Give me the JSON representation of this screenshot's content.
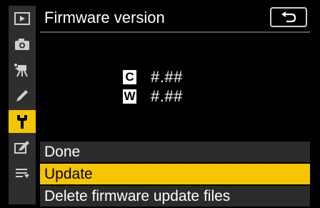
{
  "header": {
    "title": "Firmware version"
  },
  "versions": [
    {
      "badge": "C",
      "value": "#.##"
    },
    {
      "badge": "W",
      "value": "#.##"
    }
  ],
  "menu": {
    "items": [
      {
        "label": "Done",
        "selected": false
      },
      {
        "label": "Update",
        "selected": true
      },
      {
        "label": "Delete firmware update files",
        "selected": false
      }
    ]
  },
  "sidebar": {
    "items": [
      {
        "icon": "playback-icon",
        "active": false
      },
      {
        "icon": "camera-icon",
        "active": false
      },
      {
        "icon": "movie-camera-icon",
        "active": false
      },
      {
        "icon": "pencil-icon",
        "active": false
      },
      {
        "icon": "wrench-icon",
        "active": true
      },
      {
        "icon": "retouch-icon",
        "active": false
      },
      {
        "icon": "my-menu-icon",
        "active": false
      }
    ]
  },
  "colors": {
    "accent": "#f5c500",
    "menu_bg": "#2b2b2b",
    "sidebar_bg": "#2e2e2e"
  }
}
